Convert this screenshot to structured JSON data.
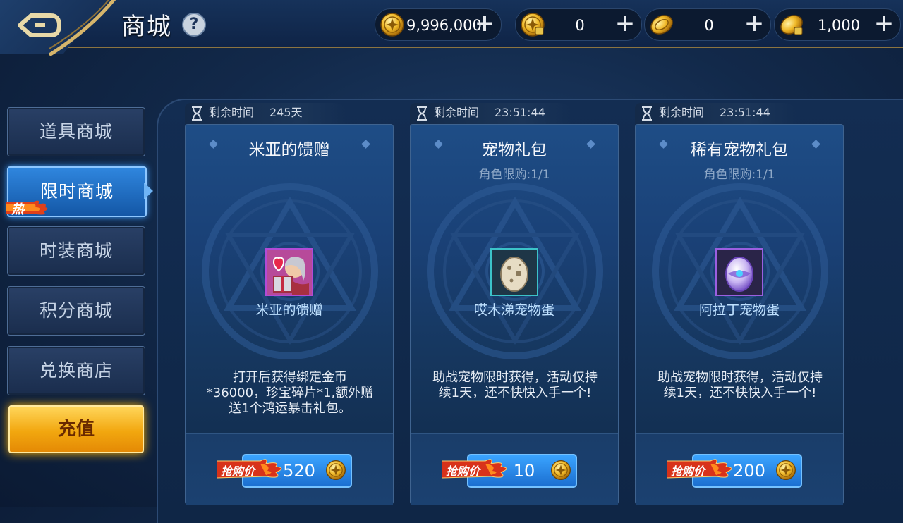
{
  "header": {
    "title": "商城",
    "help_icon": "?",
    "currencies": [
      {
        "icon": "gold-coin-icon",
        "value": "9,996,000"
      },
      {
        "icon": "bound-gold-coin-icon",
        "value": "0"
      },
      {
        "icon": "token-coin-icon",
        "value": "0"
      },
      {
        "icon": "bound-token-coin-icon",
        "value": "1,000"
      }
    ],
    "plus_label": "+"
  },
  "sidebar": {
    "items": [
      {
        "label": "道具商城"
      },
      {
        "label": "限时商城",
        "badge": "热"
      },
      {
        "label": "时装商城"
      },
      {
        "label": "积分商城"
      },
      {
        "label": "兑换商店"
      }
    ],
    "recharge_label": "充值"
  },
  "cards": [
    {
      "timer_label": "剩余时间",
      "timer_value": "245天",
      "title": "米亚的馈赠",
      "subtitle": "",
      "item_name": "米亚的馈赠",
      "description": "打开后获得绑定金币*36000，珍宝碎片*1,额外赠送1个鸿运暴击礼包。",
      "price_tag": "抢购价",
      "price": "520"
    },
    {
      "timer_label": "剩余时间",
      "timer_value": "23:51:44",
      "title": "宠物礼包",
      "subtitle": "角色限购:1/1",
      "item_name": "哎木涕宠物蛋",
      "description": "助战宠物限时获得，活动仅持续1天，还不快快入手一个!",
      "price_tag": "抢购价",
      "price": "10"
    },
    {
      "timer_label": "剩余时间",
      "timer_value": "23:51:44",
      "title": "稀有宠物礼包",
      "subtitle": "角色限购:1/1",
      "item_name": "阿拉丁宠物蛋",
      "description": "助战宠物限时获得，活动仅持续1天，还不快快入手一个!",
      "price_tag": "抢购价",
      "price": "200"
    }
  ],
  "colors": {
    "accent_gold": "#f2a70f",
    "active_tab": "#2f86de",
    "price_button": "#1b6ed0"
  }
}
